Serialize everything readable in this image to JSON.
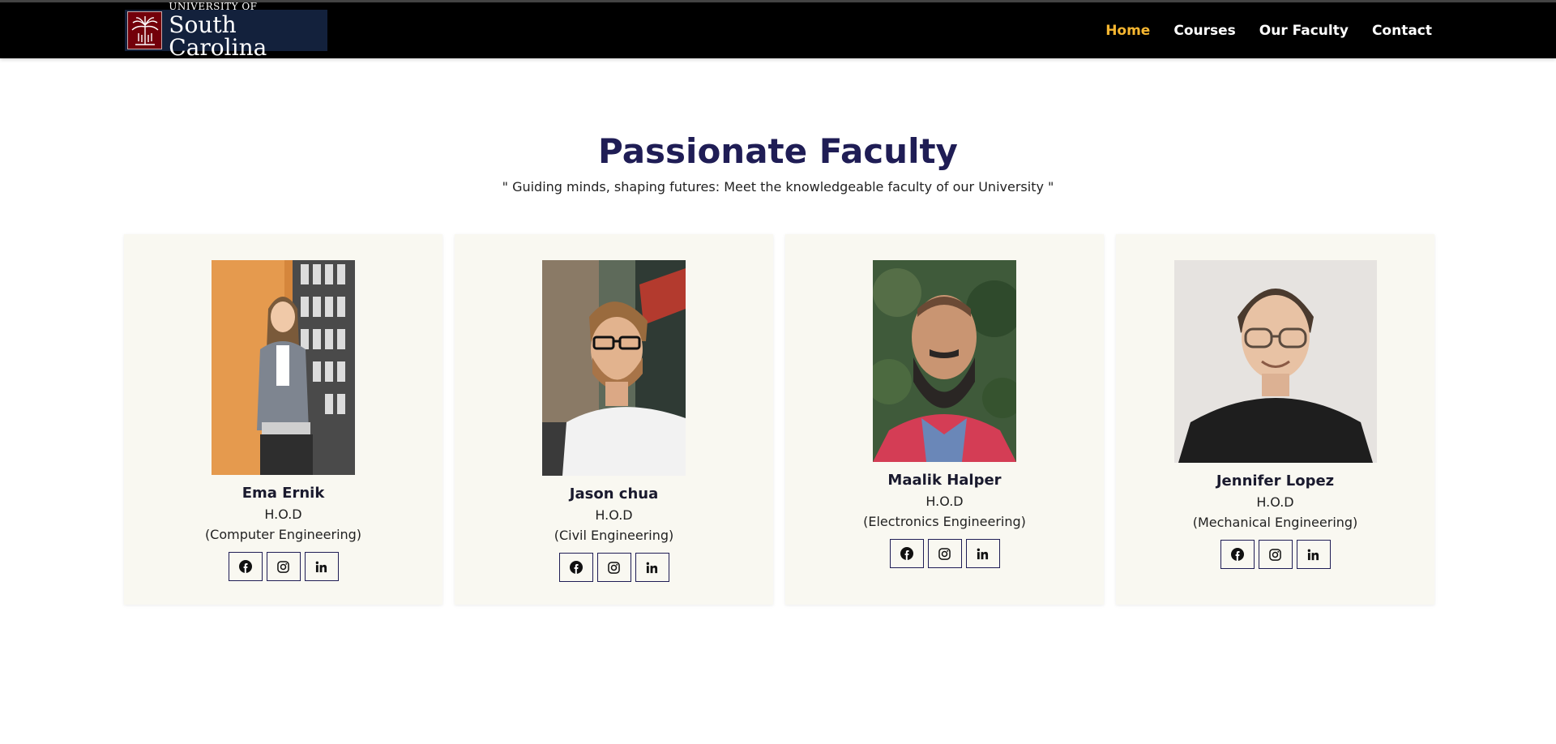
{
  "navbar": {
    "logo": {
      "top_text": "UNIVERSITY OF",
      "main_text": "South Carolina"
    },
    "links": [
      {
        "label": "Home",
        "active": true
      },
      {
        "label": "Courses",
        "active": false
      },
      {
        "label": "Our Faculty",
        "active": false
      },
      {
        "label": "Contact",
        "active": false
      }
    ],
    "active_color": "#f7b731"
  },
  "section": {
    "title": "Passionate Faculty",
    "subtitle": "\" Guiding minds, shaping futures: Meet the knowledgeable faculty of our University \""
  },
  "faculty": [
    {
      "name": "Ema Ernik",
      "role": "H.O.D",
      "department": "(Computer Engineering)"
    },
    {
      "name": "Jason chua",
      "role": "H.O.D",
      "department": "(Civil Engineering)"
    },
    {
      "name": "Maalik Halper",
      "role": "H.O.D",
      "department": "(Electronics Engineering)"
    },
    {
      "name": "Jennifer Lopez",
      "role": "H.O.D",
      "department": "(Mechanical Engineering)"
    }
  ],
  "social_icons": [
    "facebook-icon",
    "instagram-icon",
    "linkedin-icon"
  ],
  "colors": {
    "heading": "#1f1d55",
    "card_bg": "#f9f8f1",
    "navbar_bg": "#000000",
    "brand_red": "#73000a"
  }
}
